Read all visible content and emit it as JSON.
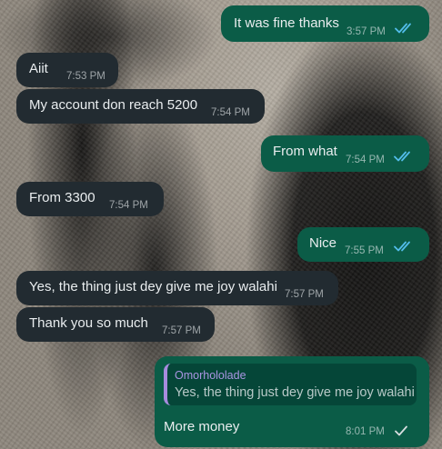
{
  "messages": [
    {
      "direction": "outgoing",
      "text": "It was fine thanks",
      "time": "3:57 PM",
      "status": "read"
    },
    {
      "direction": "incoming",
      "text": "Aiit",
      "time": "7:53 PM"
    },
    {
      "direction": "incoming",
      "text": "My account don reach 5200",
      "time": "7:54 PM"
    },
    {
      "direction": "outgoing",
      "text": "From what",
      "time": "7:54 PM",
      "status": "read"
    },
    {
      "direction": "incoming",
      "text": "From 3300",
      "time": "7:54 PM"
    },
    {
      "direction": "outgoing",
      "text": "Nice",
      "time": "7:55 PM",
      "status": "read"
    },
    {
      "direction": "incoming",
      "text": "Yes, the thing just dey give me joy walahi",
      "time": "7:57 PM"
    },
    {
      "direction": "incoming",
      "text": "Thank you so much",
      "time": "7:57 PM"
    },
    {
      "direction": "outgoing",
      "reply_to": {
        "author": "Omorhololade",
        "text": "Yes, the thing just dey give me joy walahi"
      },
      "text": "More money",
      "time": "8:01 PM",
      "status": "delivered"
    }
  ],
  "icons": {
    "read": "double-check-icon",
    "delivered": "single-check-icon"
  },
  "colors": {
    "incoming_bubble": "#222b31",
    "outgoing_bubble": "#0b5c47",
    "quote_background": "#054638",
    "quote_accent": "#a78bde",
    "read_tick": "#53bdeb",
    "delivered_tick": "#d9dee0"
  }
}
